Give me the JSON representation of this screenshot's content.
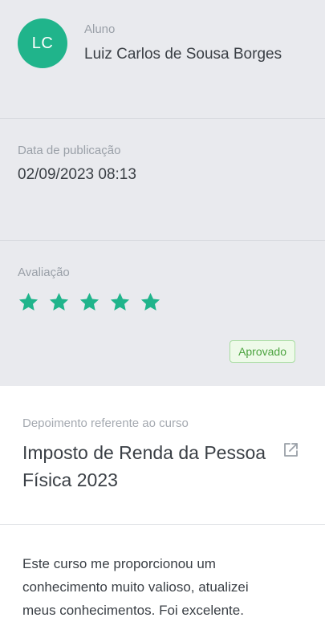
{
  "student": {
    "initials": "LC",
    "label": "Aluno",
    "name": "Luiz Carlos de Sousa Borges"
  },
  "publication": {
    "label": "Data de publicação",
    "date": "02/09/2023 08:13"
  },
  "rating": {
    "label": "Avaliação",
    "stars": 5,
    "max_stars": 5,
    "status": "Aprovado"
  },
  "course": {
    "label": "Depoimento referente ao curso",
    "title_line1": "Imposto de Renda da Pessoa",
    "title_line2": "Física 2023",
    "link_icon": "external-link-icon"
  },
  "testimonial": {
    "line1": "Este curso me proporcionou um",
    "line2": "conhecimento muito valioso, atualizei",
    "line3": "meus conhecimentos. Foi excelente."
  },
  "colors": {
    "accent": "#20b48b",
    "star": "#20b48b",
    "badge_text": "#4ba33f",
    "badge_bg": "#eefae9",
    "badge_border": "#a8dda1",
    "gray_bg": "#e9eaee"
  }
}
